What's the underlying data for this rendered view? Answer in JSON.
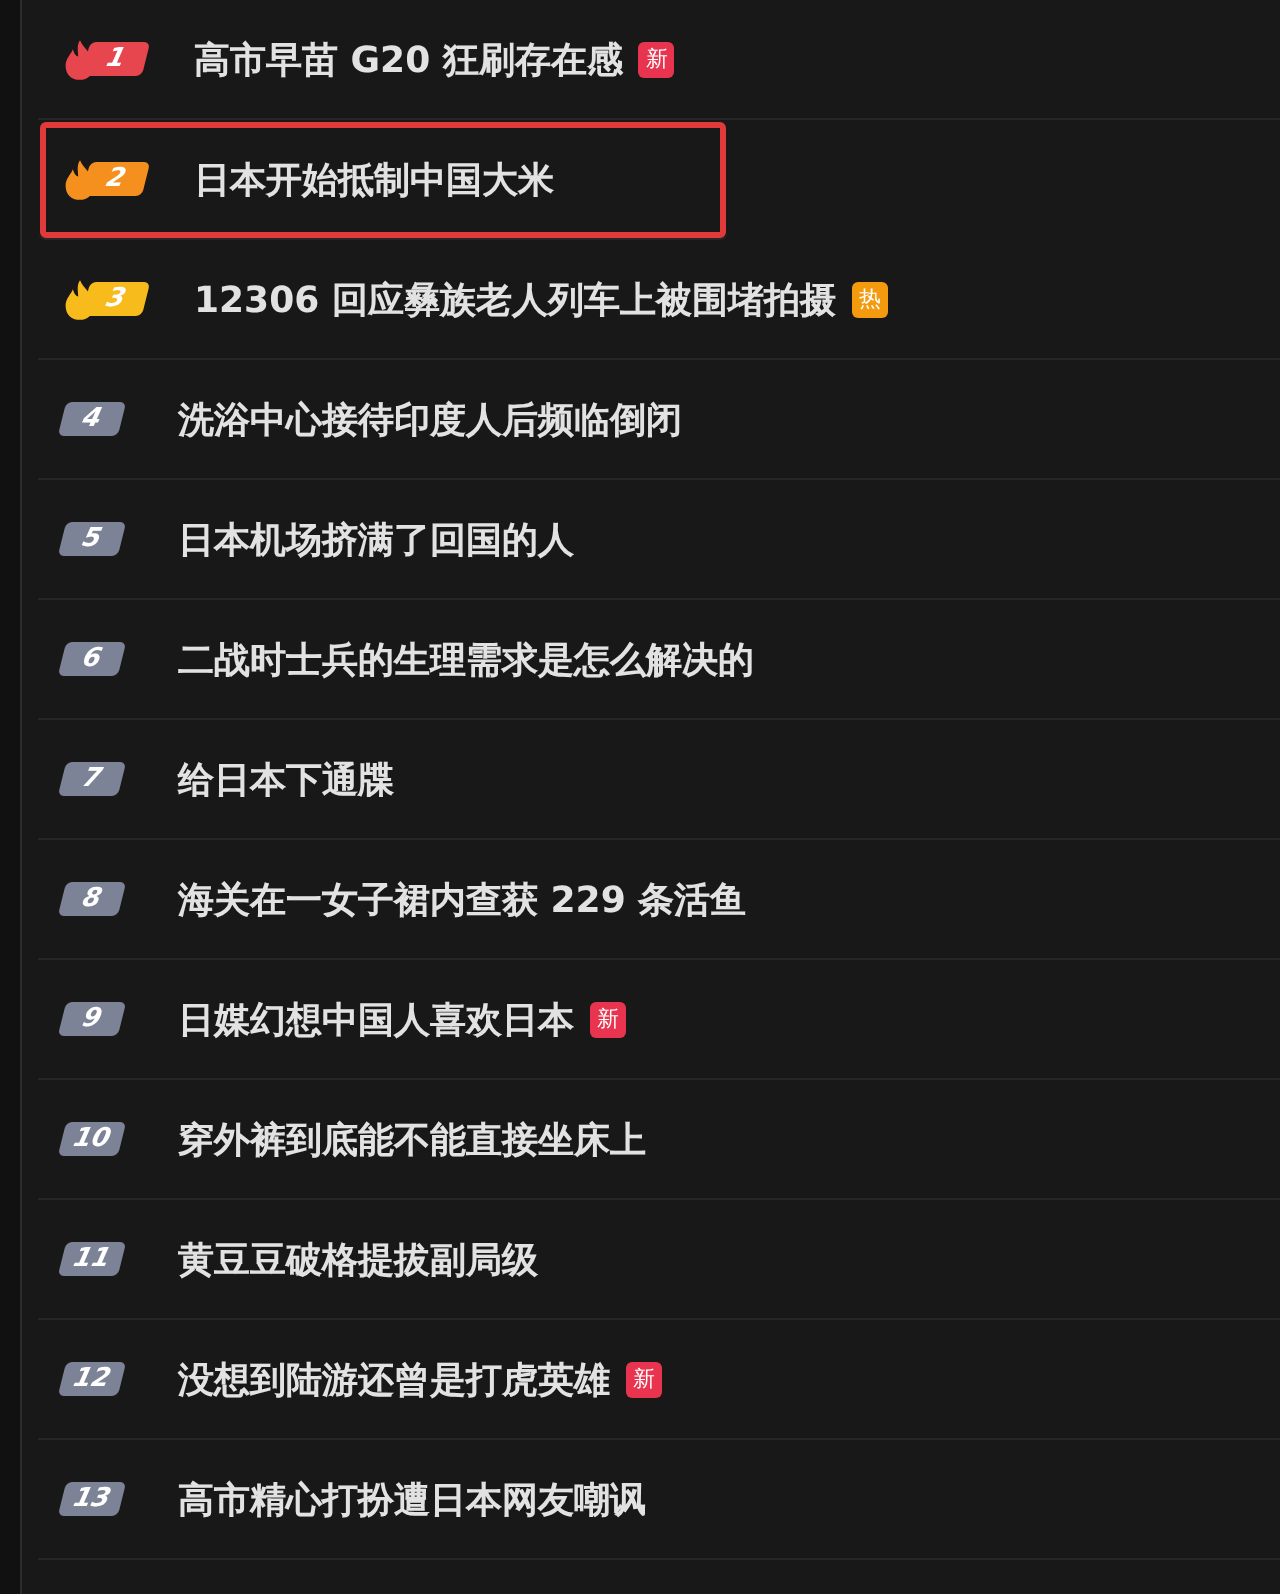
{
  "items": [
    {
      "rank": "1",
      "title": "高市早苗 G20 狂刷存在感",
      "kind": "flame",
      "color": "#e8464e",
      "tag": {
        "kind": "new",
        "label": "新"
      },
      "selected": false
    },
    {
      "rank": "2",
      "title": "日本开始抵制中国大米",
      "kind": "flame",
      "color": "#f5901e",
      "selected": true
    },
    {
      "rank": "3",
      "title": "12306 回应彝族老人列车上被围堵拍摄",
      "kind": "flame",
      "color": "#f7bb1c",
      "tag": {
        "kind": "hot",
        "label": "热"
      },
      "selected": false
    },
    {
      "rank": "4",
      "title": "洗浴中心接待印度人后频临倒闭",
      "kind": "plain",
      "color": "#7d8396",
      "selected": false
    },
    {
      "rank": "5",
      "title": "日本机场挤满了回国的人",
      "kind": "plain",
      "color": "#7d8396",
      "selected": false
    },
    {
      "rank": "6",
      "title": "二战时士兵的生理需求是怎么解决的",
      "kind": "plain",
      "color": "#7d8396",
      "selected": false
    },
    {
      "rank": "7",
      "title": "给日本下通牒",
      "kind": "plain",
      "color": "#7d8396",
      "selected": false
    },
    {
      "rank": "8",
      "title": "海关在一女子裙内查获 229 条活鱼",
      "kind": "plain",
      "color": "#7d8396",
      "selected": false
    },
    {
      "rank": "9",
      "title": "日媒幻想中国人喜欢日本",
      "kind": "plain",
      "color": "#7d8396",
      "tag": {
        "kind": "new",
        "label": "新"
      },
      "selected": false
    },
    {
      "rank": "10",
      "title": "穿外裤到底能不能直接坐床上",
      "kind": "plain",
      "color": "#7d8396",
      "selected": false
    },
    {
      "rank": "11",
      "title": "黄豆豆破格提拔副局级",
      "kind": "plain",
      "color": "#7d8396",
      "selected": false
    },
    {
      "rank": "12",
      "title": "没想到陆游还曾是打虎英雄",
      "kind": "plain",
      "color": "#7d8396",
      "tag": {
        "kind": "new",
        "label": "新"
      },
      "selected": false
    },
    {
      "rank": "13",
      "title": "高市精心打扮遭日本网友嘲讽",
      "kind": "plain",
      "color": "#7d8396",
      "selected": false
    }
  ]
}
